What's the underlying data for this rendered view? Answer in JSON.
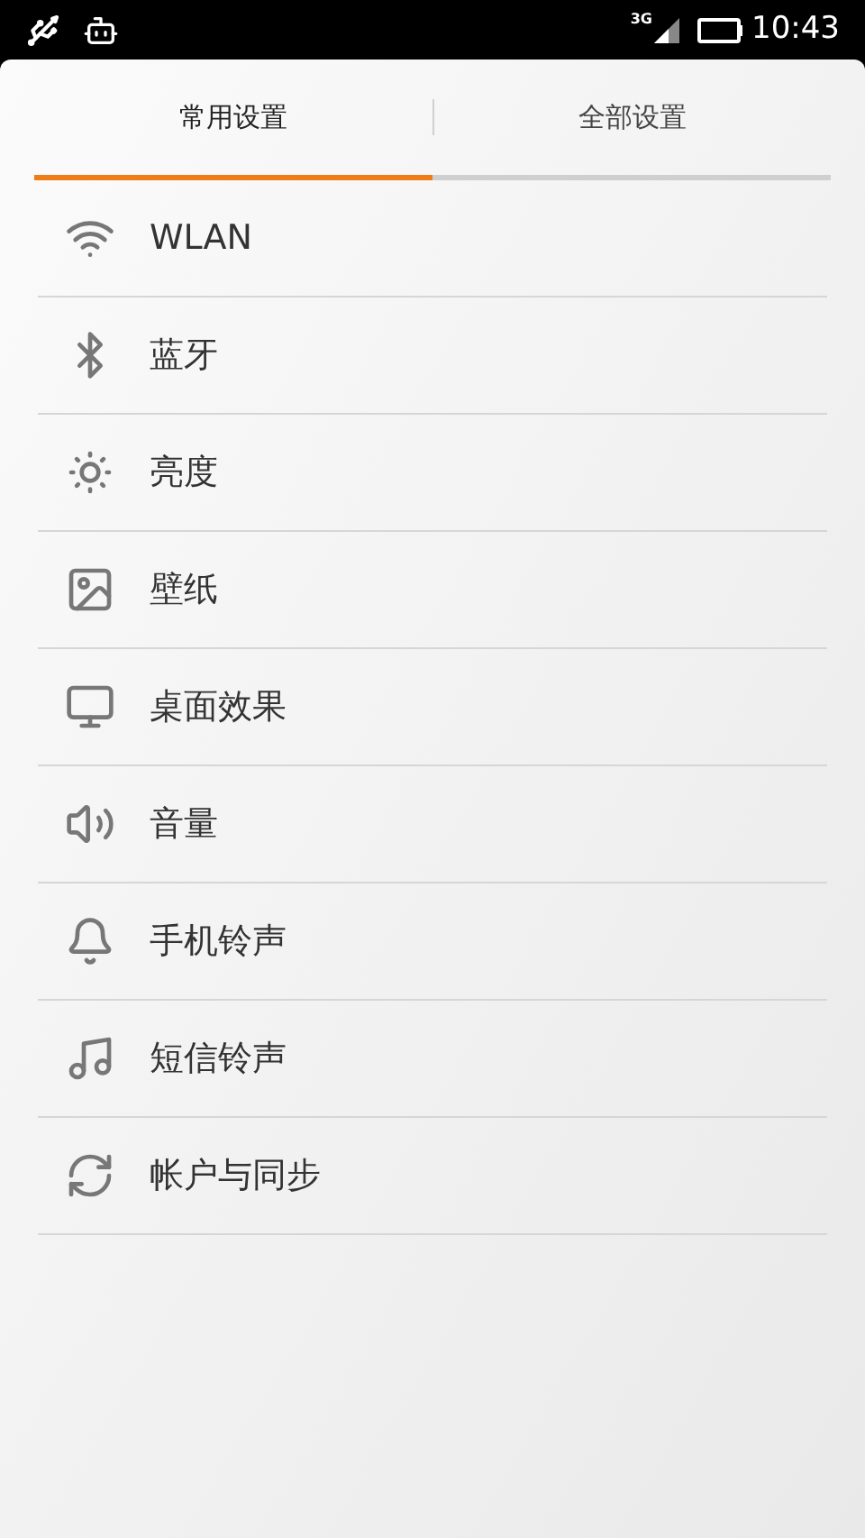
{
  "status_bar": {
    "network": "3G",
    "time": "10:43"
  },
  "tabs": [
    {
      "label": "常用设置",
      "selected": true
    },
    {
      "label": "全部设置",
      "selected": false
    }
  ],
  "settings": [
    {
      "kind": "wifi",
      "label": "WLAN"
    },
    {
      "kind": "bluetooth",
      "label": "蓝牙"
    },
    {
      "kind": "brightness",
      "label": "亮度"
    },
    {
      "kind": "wallpaper",
      "label": "壁纸"
    },
    {
      "kind": "desktop",
      "label": "桌面效果"
    },
    {
      "kind": "volume",
      "label": "音量"
    },
    {
      "kind": "ringtone",
      "label": "手机铃声"
    },
    {
      "kind": "sms",
      "label": "短信铃声"
    },
    {
      "kind": "sync",
      "label": "帐户与同步"
    }
  ]
}
